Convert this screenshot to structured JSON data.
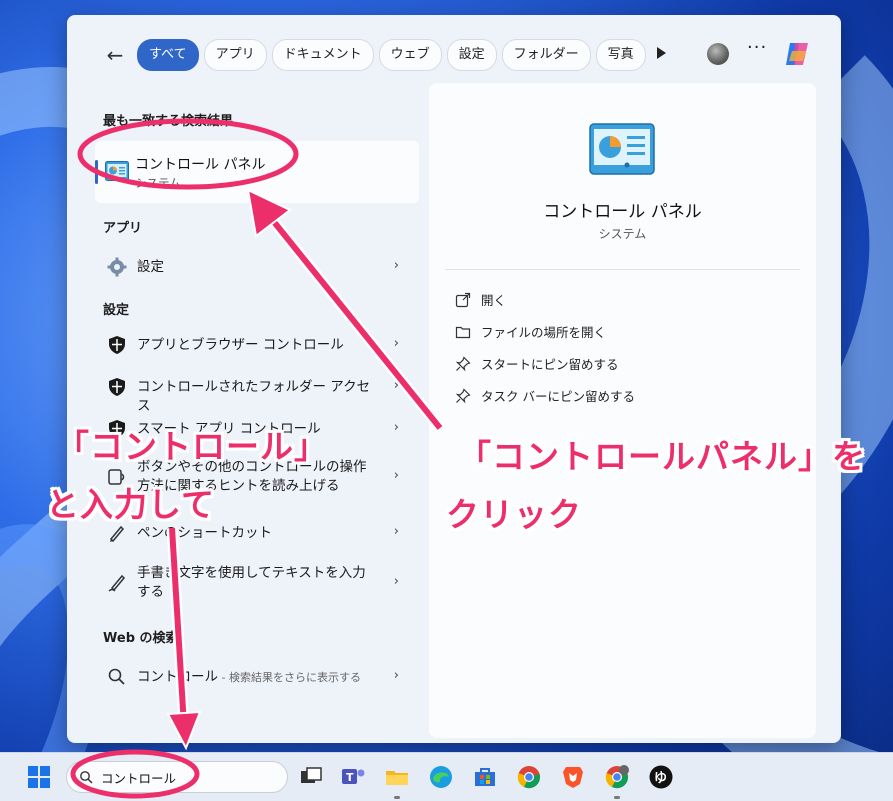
{
  "search_panel": {
    "filters": [
      "すべて",
      "アプリ",
      "ドキュメント",
      "ウェブ",
      "設定",
      "フォルダー",
      "写真"
    ],
    "active_filter_index": 0,
    "best_match_header": "最も一致する検索結果",
    "best_match": {
      "title": "コントロール パネル",
      "subtitle": "システム"
    },
    "apps_header": "アプリ",
    "apps": [
      {
        "label": "設定"
      }
    ],
    "settings_header": "設定",
    "settings": [
      {
        "label": "アプリとブラウザー コントロール"
      },
      {
        "label": "コントロールされたフォルダー アクセス"
      },
      {
        "label": "スマート アプリ コントロール"
      },
      {
        "label": "ボタンやその他のコントロールの操作方法に関するヒントを読み上げる"
      },
      {
        "label": "ペンのショートカット"
      },
      {
        "label": "手書き文字を使用してテキストを入力する"
      }
    ],
    "web_header": "Web の検索",
    "web": {
      "label": "コントロール",
      "suffix": " - 検索結果をさらに表示する"
    }
  },
  "detail": {
    "title": "コントロール パネル",
    "subtitle": "システム",
    "actions": [
      "開く",
      "ファイルの場所を開く",
      "スタートにピン留めする",
      "タスク バーにピン留めする"
    ]
  },
  "taskbar": {
    "search_value": "コントロール",
    "apps": [
      "task-view-icon",
      "teams-icon",
      "file-explorer-icon",
      "edge-icon",
      "store-icon",
      "chrome-icon",
      "brave-icon",
      "chrome-profile-icon",
      "yu-app-icon"
    ]
  },
  "annotations": {
    "left_line1": "「コントロール」",
    "left_line2": "と入力して",
    "right_line1": "「コントロールパネル」を",
    "right_line2": "クリック"
  },
  "colors": {
    "accent": "#2f66c8",
    "annotation": "#ec2f6b"
  }
}
